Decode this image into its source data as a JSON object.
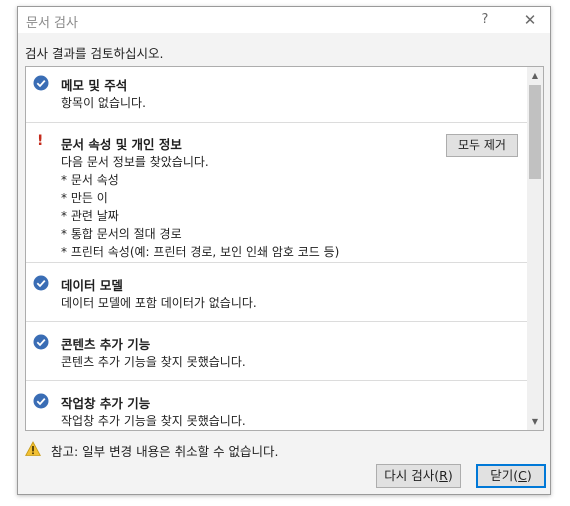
{
  "dialog": {
    "title": "문서 검사",
    "help_glyph": "?",
    "close_glyph": "✕",
    "instruction": "검사 결과를 검토하십시오."
  },
  "results": [
    {
      "status": "ok",
      "icon": "check-circle-icon",
      "title": "메모 및 주석",
      "description": "항목이 없습니다."
    },
    {
      "status": "warning",
      "icon": "exclamation-icon",
      "mark": "!",
      "title": "문서 속성 및 개인 정보",
      "description": "다음 문서 정보를 찾았습니다.",
      "details": [
        "* 문서 속성",
        "* 만든 이",
        "* 관련 날짜",
        "* 통합 문서의 절대 경로",
        "* 프린터 속성(예: 프린터 경로, 보인 인쇄 암호 코드 등)"
      ],
      "action_label": "모두 제거"
    },
    {
      "status": "ok",
      "icon": "check-circle-icon",
      "title": "데이터 모델",
      "description": "데이터 모델에 포함 데이터가 없습니다."
    },
    {
      "status": "ok",
      "icon": "check-circle-icon",
      "title": "콘텐츠 추가 기능",
      "description": "콘텐츠 추가 기능을 찾지 못했습니다."
    },
    {
      "status": "ok",
      "icon": "check-circle-icon",
      "title": "작업창 추가 기능",
      "description": "작업창 추가 기능을 찾지 못했습니다."
    }
  ],
  "footer": {
    "icon": "warning-triangle-icon",
    "note": "참고: 일부 변경 내용은 취소할 수 없습니다."
  },
  "buttons": {
    "reinspect_label": "다시 검사(",
    "reinspect_key": "R",
    "reinspect_suffix": ")",
    "close_label": "닫기(",
    "close_key": "C",
    "close_suffix": ")"
  },
  "colors": {
    "check_blue": "#3a6db5",
    "warning_red": "#c42b1c",
    "accent": "#0078d7"
  }
}
